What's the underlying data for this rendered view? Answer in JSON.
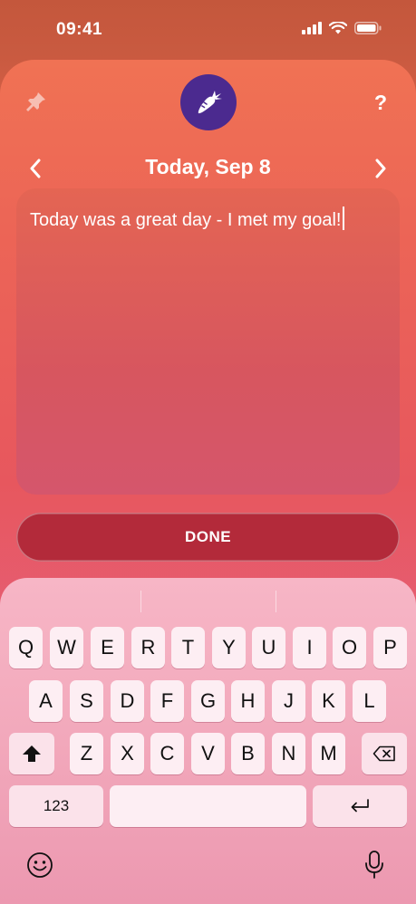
{
  "status": {
    "time": "09:41"
  },
  "header": {
    "help_label": "?"
  },
  "date_nav": {
    "title": "Today, Sep 8"
  },
  "note": {
    "text": "Today was a great day - I met my goal!"
  },
  "done_button": {
    "label": "DONE"
  },
  "keyboard": {
    "row1": [
      "Q",
      "W",
      "E",
      "R",
      "T",
      "Y",
      "U",
      "I",
      "O",
      "P"
    ],
    "row2": [
      "A",
      "S",
      "D",
      "F",
      "G",
      "H",
      "J",
      "K",
      "L"
    ],
    "row3": [
      "Z",
      "X",
      "C",
      "V",
      "B",
      "N",
      "M"
    ],
    "numbers_label": "123"
  },
  "icons": {
    "pin": "pin-icon",
    "logo": "carrot-icon",
    "prev": "chevron-left-icon",
    "next": "chevron-right-icon",
    "shift": "shift-icon",
    "backspace": "backspace-icon",
    "return": "return-icon",
    "emoji": "emoji-icon",
    "mic": "microphone-icon"
  },
  "colors": {
    "logo_bg": "#4b2a8f",
    "done_bg": "#b32a3a"
  }
}
